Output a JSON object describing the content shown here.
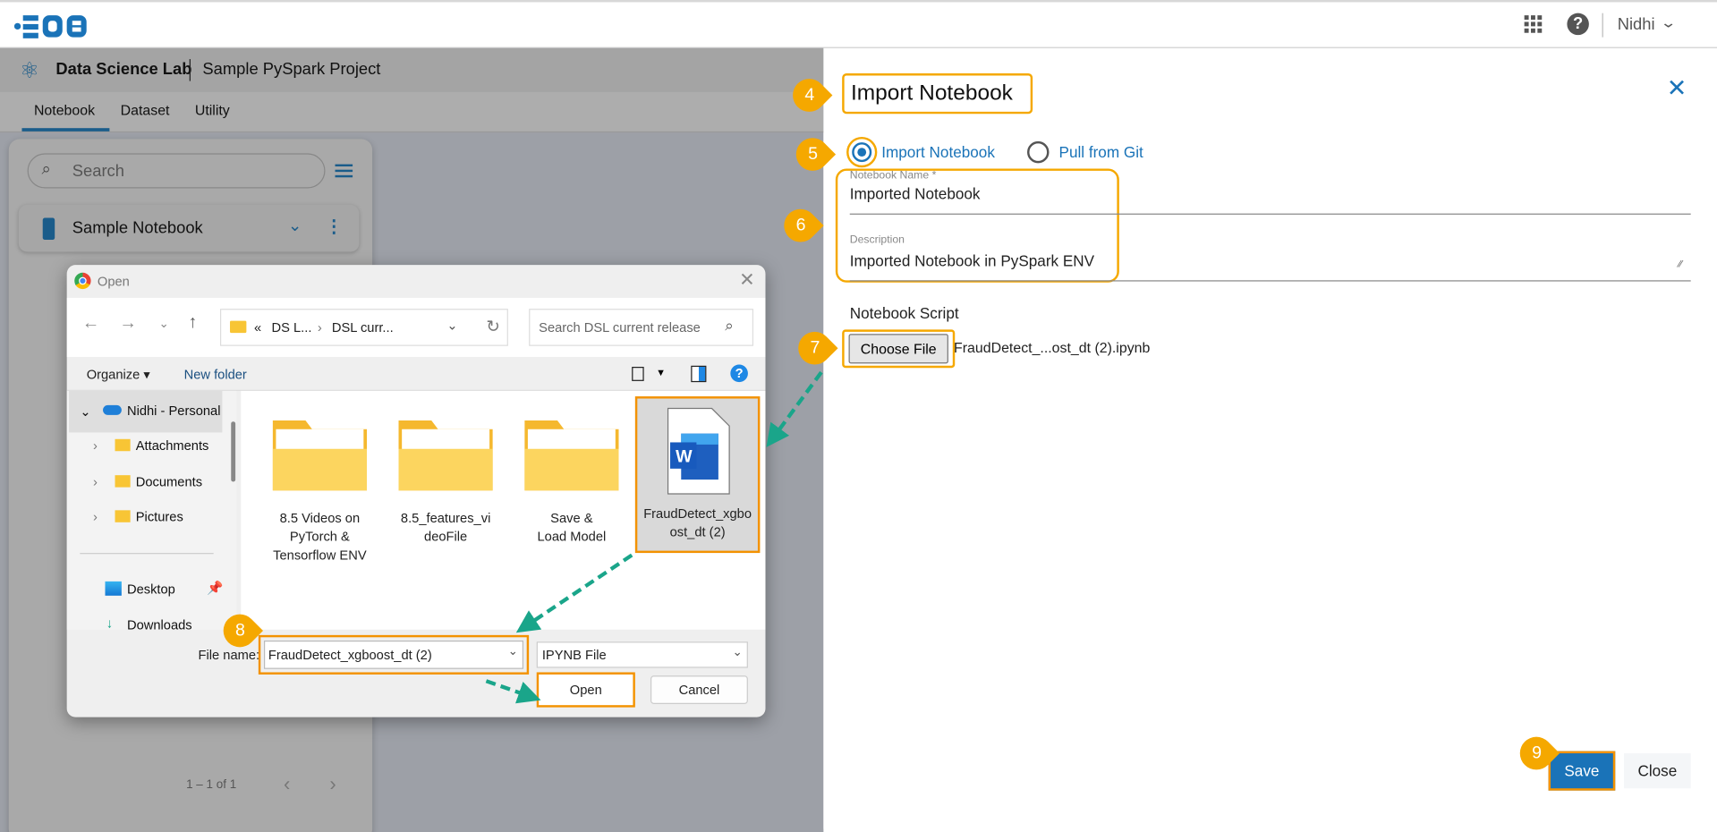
{
  "topbar": {
    "user": "Nidhi",
    "icons": [
      "bdb-logo",
      "apps-grid-icon",
      "help-icon",
      "chevron-down-icon"
    ]
  },
  "app": {
    "name": "Data Science Lab",
    "project": "Sample PySpark Project"
  },
  "tabs": [
    {
      "label": "Notebook",
      "active": true
    },
    {
      "label": "Dataset"
    },
    {
      "label": "Utility"
    }
  ],
  "sidebar": {
    "search_placeholder": "Search",
    "items": [
      {
        "label": "Sample Notebook"
      }
    ],
    "pager": "1 – 1 of 1"
  },
  "file_dialog": {
    "title": "Open",
    "breadcrumb": [
      "«",
      "DS L...",
      "DSL curr..."
    ],
    "search_placeholder": "Search DSL current release",
    "organize": "Organize",
    "new_folder": "New folder",
    "nav": [
      {
        "label": "Nidhi - Personal",
        "selected": true
      },
      {
        "label": "Attachments"
      },
      {
        "label": "Documents"
      },
      {
        "label": "Pictures"
      },
      {
        "label": "Desktop"
      },
      {
        "label": "Downloads"
      }
    ],
    "items": [
      {
        "label": "8.5 Videos on PyTorch & Tensorflow ENV",
        "type": "folder"
      },
      {
        "label": "8.5_features_videoFile",
        "type": "folder"
      },
      {
        "label": "Save & Load Model",
        "type": "folder"
      },
      {
        "label": "FraudDetect_xgboost_dt (2)",
        "type": "word-file",
        "selected": true
      }
    ],
    "file_name_label": "File name:",
    "file_name_value": "FraudDetect_xgboost_dt (2)",
    "file_type": "IPYNB File",
    "open": "Open",
    "cancel": "Cancel"
  },
  "panel": {
    "title": "Import Notebook",
    "radio": [
      {
        "label": "Import Notebook",
        "selected": true
      },
      {
        "label": "Pull from Git",
        "selected": false
      }
    ],
    "name_label": "Notebook Name *",
    "name_value": "Imported Notebook",
    "desc_label": "Description",
    "desc_value": "Imported Notebook in PySpark ENV",
    "script_label": "Notebook Script",
    "choose_file": "Choose File",
    "chosen_file": "FraudDetect_...ost_dt (2).ipynb",
    "save": "Save",
    "close": "Close"
  },
  "steps": [
    "4",
    "5",
    "6",
    "7",
    "8",
    "9"
  ],
  "colors": {
    "accent": "#1a73b8",
    "highlight": "#f39200",
    "badge": "#f5a800",
    "arrow": "#1aa58a"
  }
}
